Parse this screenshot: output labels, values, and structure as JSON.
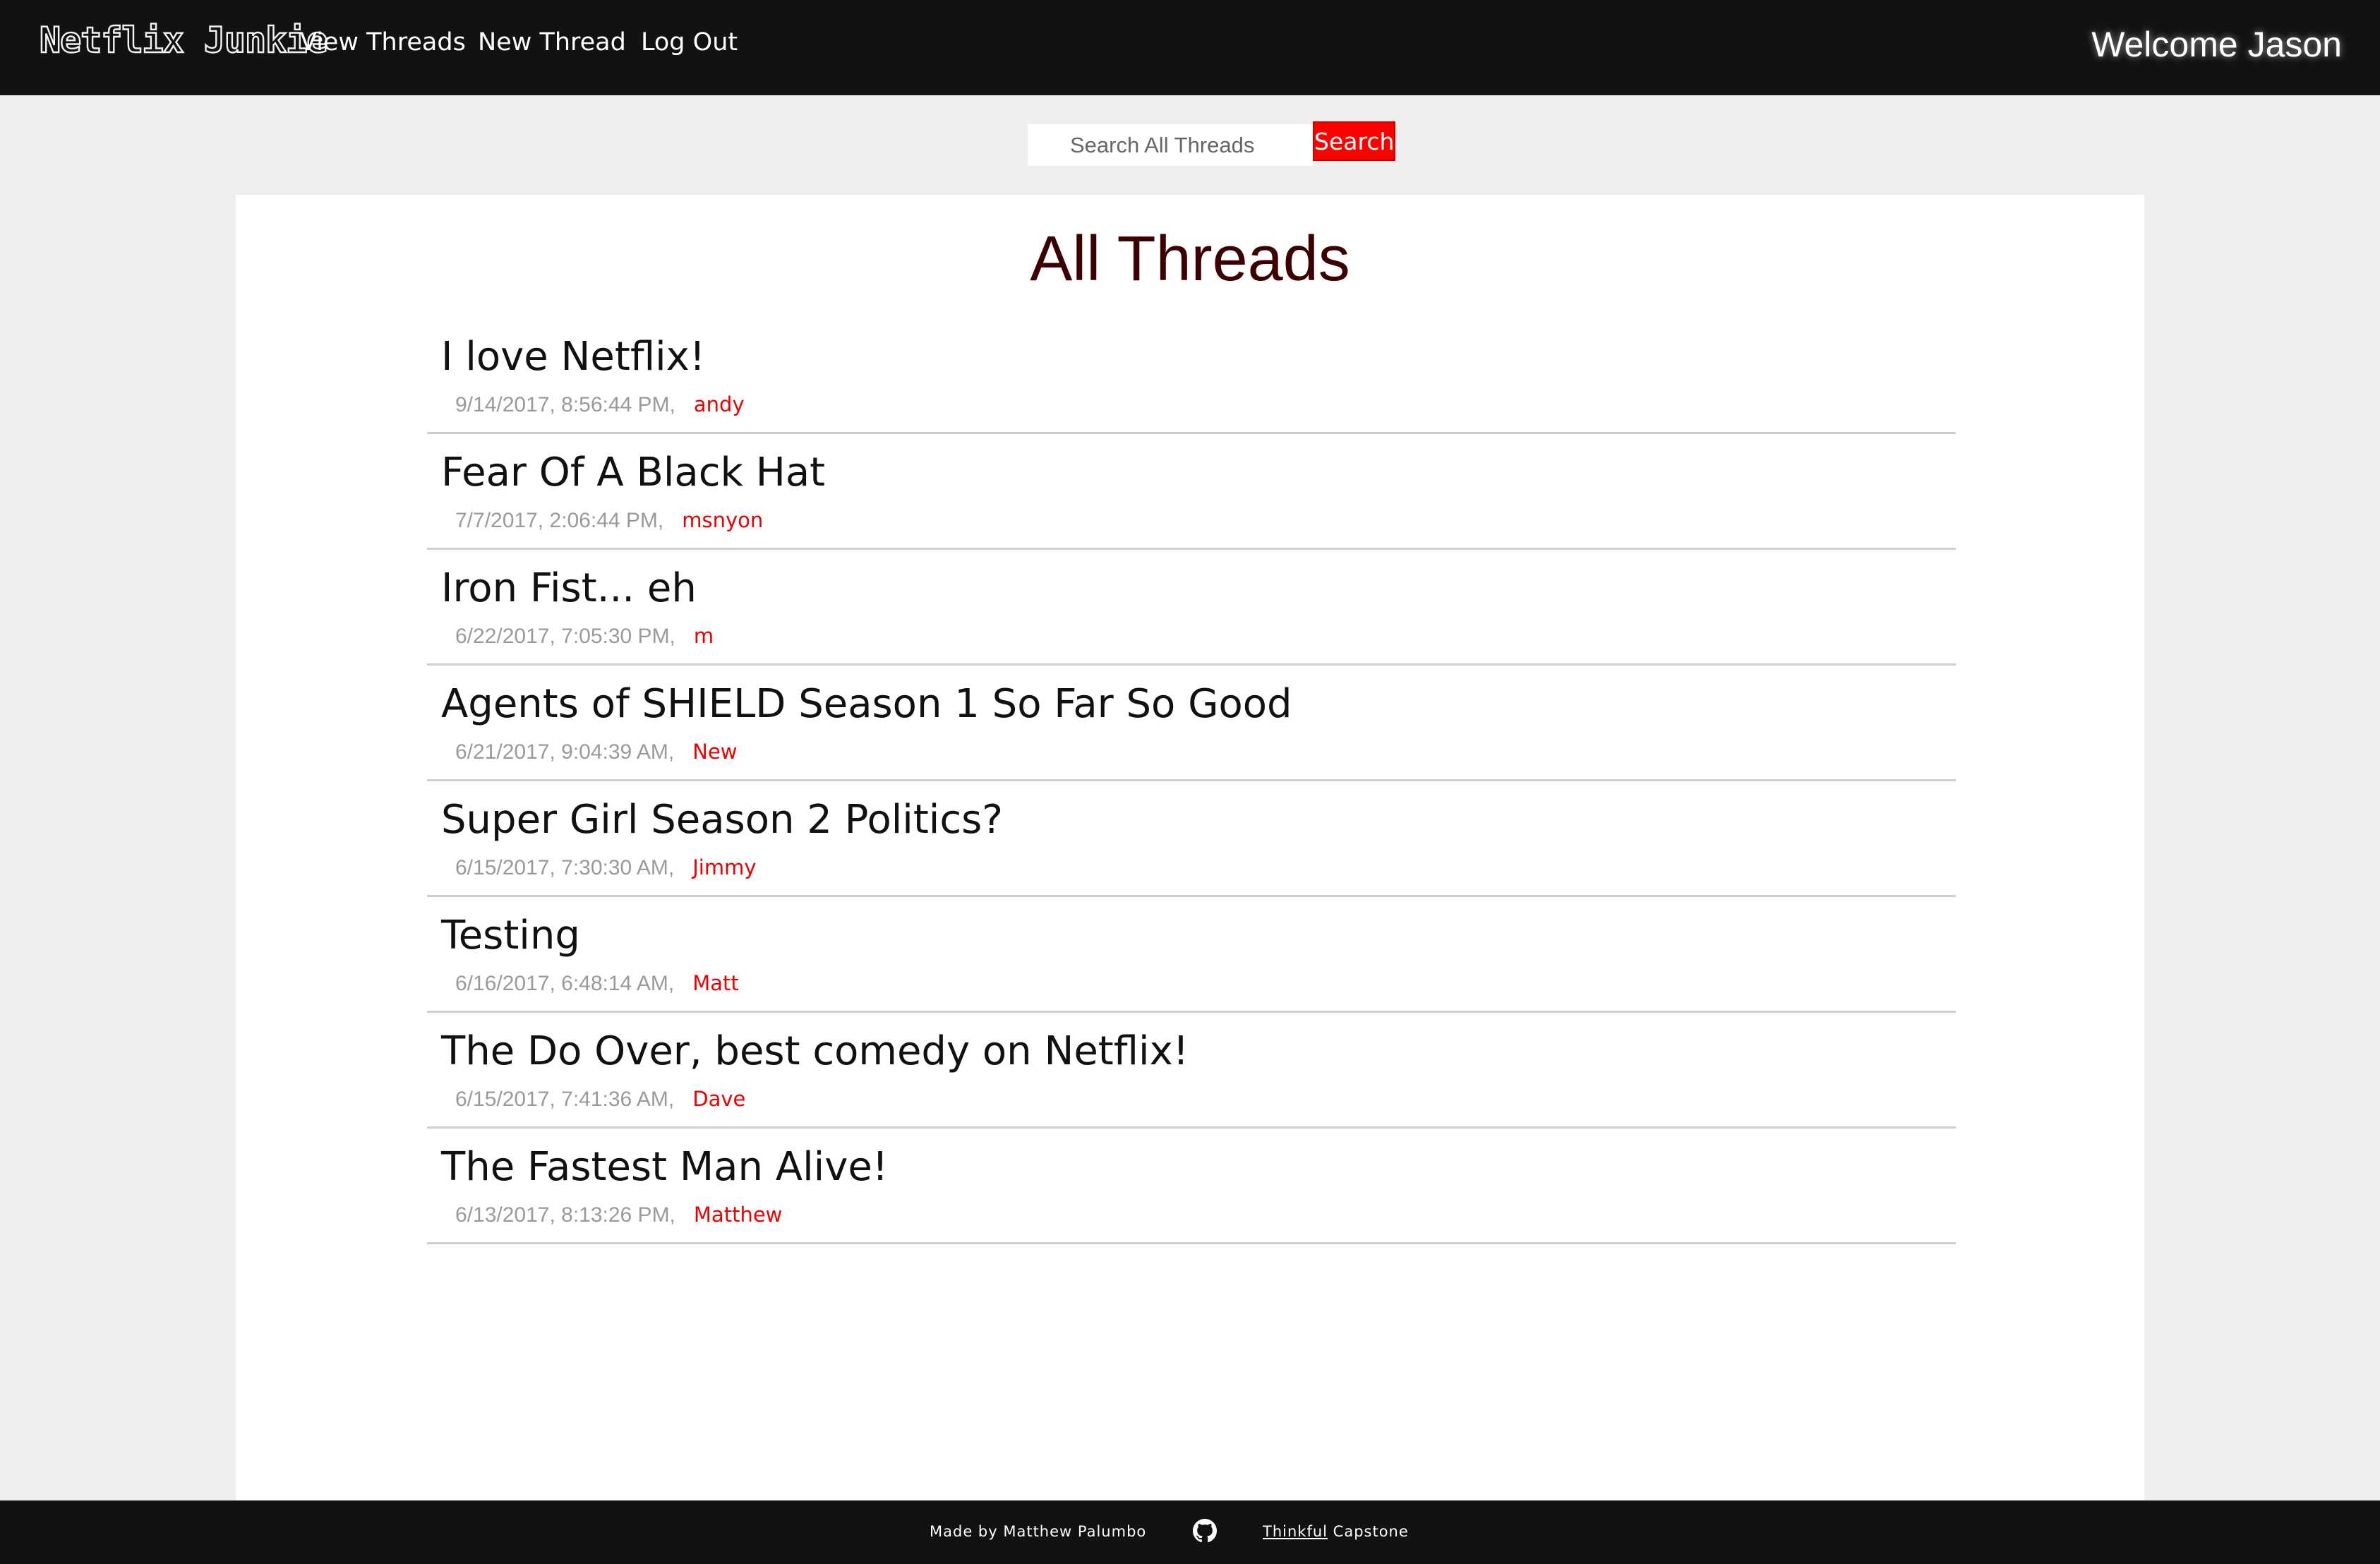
{
  "header": {
    "brand": "Netflix Junkie",
    "nav": {
      "view_threads": "View Threads",
      "new_thread": "New Thread",
      "log_out": "Log Out"
    },
    "welcome": "Welcome Jason"
  },
  "search": {
    "placeholder": "Search All Threads",
    "value": "",
    "button_label": "Search"
  },
  "main": {
    "title": "All Threads",
    "threads": [
      {
        "title": "I love Netflix!",
        "date": "9/14/2017, 8:56:44 PM,",
        "author": "andy"
      },
      {
        "title": "Fear Of A Black Hat",
        "date": "7/7/2017, 2:06:44 PM,",
        "author": "msnyon"
      },
      {
        "title": "Iron Fist... eh",
        "date": "6/22/2017, 7:05:30 PM,",
        "author": "m"
      },
      {
        "title": "Agents of SHIELD Season 1 So Far So Good",
        "date": "6/21/2017, 9:04:39 AM,",
        "author": "New"
      },
      {
        "title": "Super Girl Season 2 Politics?",
        "date": "6/15/2017, 7:30:30 AM,",
        "author": "Jimmy"
      },
      {
        "title": "Testing",
        "date": "6/16/2017, 6:48:14 AM,",
        "author": "Matt"
      },
      {
        "title": "The Do Over, best comedy on Netflix!",
        "date": "6/15/2017, 7:41:36 AM,",
        "author": "Dave"
      },
      {
        "title": "The Fastest Man Alive!",
        "date": "6/13/2017, 8:13:26 PM,",
        "author": "Matthew"
      }
    ]
  },
  "footer": {
    "made_by": "Made by Matthew Palumbo",
    "github_icon": "github-icon",
    "link_label": "Thinkful",
    "suffix": " Capstone"
  },
  "colors": {
    "nav_bg": "#121212",
    "page_bg": "#efefef",
    "accent_red": "#ff0000",
    "title_color": "#3c0000",
    "author_color": "#ee0000",
    "date_color": "#9a9a9a"
  }
}
